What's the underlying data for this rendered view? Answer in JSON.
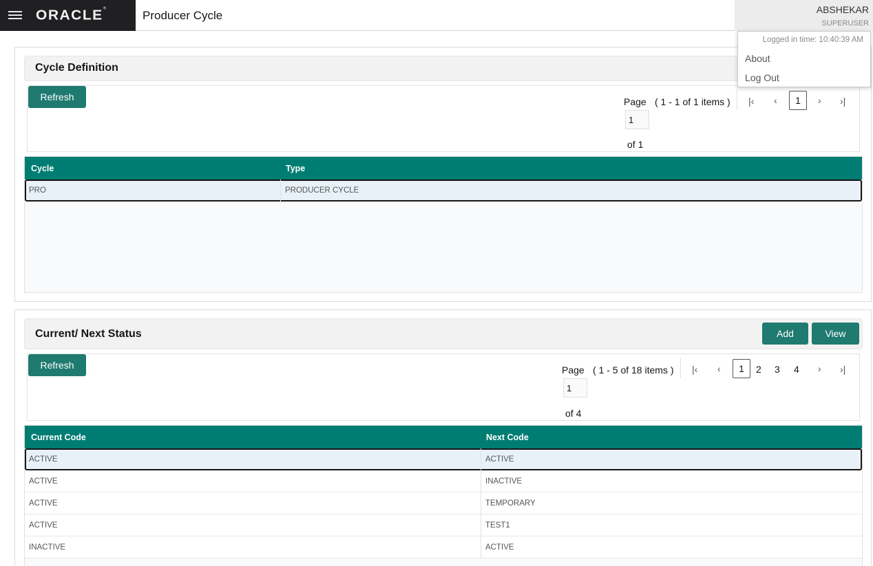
{
  "header": {
    "page_title": "Producer Cycle",
    "logo_text": "ORACLE",
    "logo_mark": "®",
    "user_name": "ABSHEKAR",
    "user_role": "SUPERUSER"
  },
  "user_menu": {
    "logged_time": "Logged in time: 10:40:39 AM",
    "items": [
      {
        "label": "About"
      },
      {
        "label": "Log Out"
      }
    ]
  },
  "cycle_definition": {
    "title": "Cycle Definition",
    "refresh_label": "Refresh",
    "pager": {
      "page_label": "Page",
      "items_info": "( 1 - 1 of 1 items )",
      "page_value": "1",
      "of_text": "of 1",
      "pages": [
        "1"
      ],
      "current_page": "1"
    },
    "columns": [
      "Cycle",
      "Type"
    ],
    "rows": [
      [
        "PRO",
        "PRODUCER CYCLE"
      ]
    ]
  },
  "current_next_status": {
    "title": "Current/ Next Status",
    "add_label": "Add",
    "view_label": "View",
    "refresh_label": "Refresh",
    "pager": {
      "page_label": "Page",
      "items_info": "( 1 - 5 of 18 items )",
      "page_value": "1",
      "of_text": "of 4",
      "pages": [
        "1",
        "2",
        "3",
        "4"
      ],
      "current_page": "1"
    },
    "columns": [
      "Current Code",
      "Next Code"
    ],
    "rows": [
      [
        "ACTIVE",
        "ACTIVE"
      ],
      [
        "ACTIVE",
        "INACTIVE"
      ],
      [
        "ACTIVE",
        "TEMPORARY"
      ],
      [
        "ACTIVE",
        "TEST1"
      ],
      [
        "INACTIVE",
        "ACTIVE"
      ]
    ]
  },
  "icons": {
    "menu": "hamburger-icon",
    "first": "first-page-icon",
    "prev": "prev-page-icon",
    "next": "next-page-icon",
    "last": "last-page-icon"
  },
  "colors": {
    "accent": "#007d73",
    "button": "#1f7a70",
    "brand_bg": "#201f22"
  }
}
